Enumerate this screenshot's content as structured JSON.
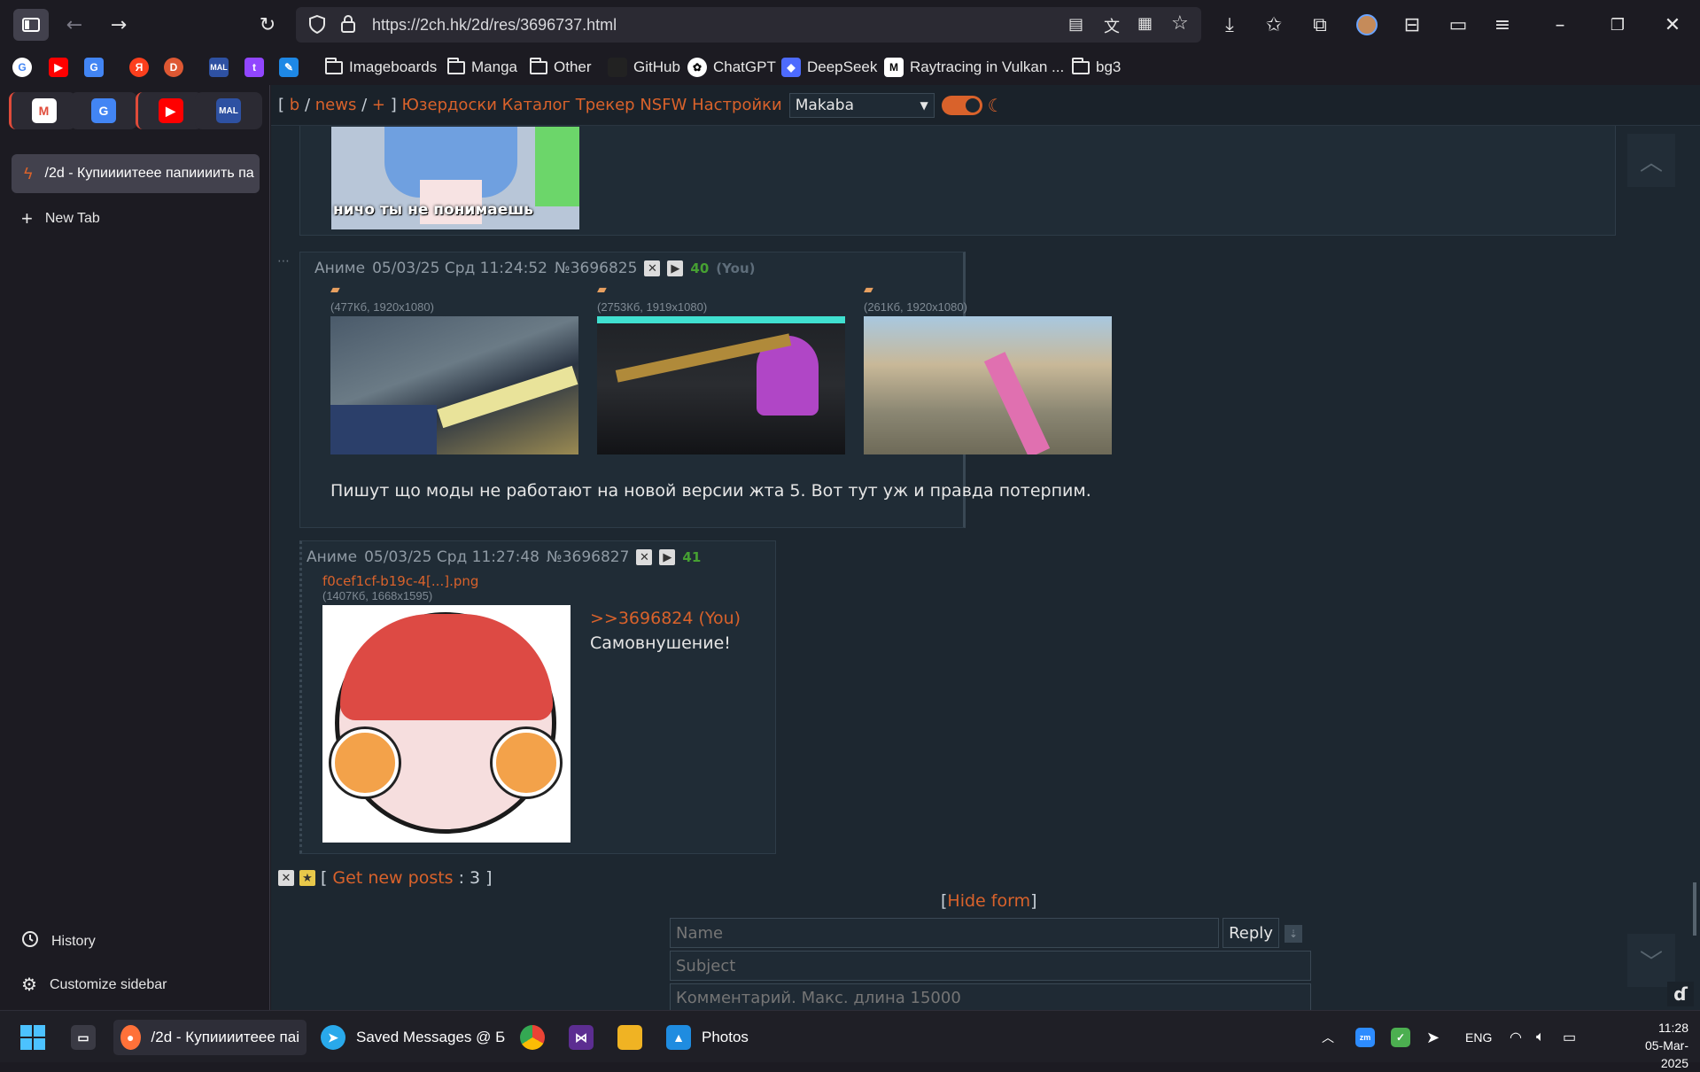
{
  "browser": {
    "url": "https://2ch.hk/2d/res/3696737.html",
    "bookmarks": [
      "Imageboards",
      "Manga",
      "Other",
      "GitHub",
      "ChatGPT",
      "DeepSeek",
      "Raytracing in Vulkan ...",
      "bg3"
    ],
    "bookmark_icon_labels": {
      "mal": "MAL",
      "yandex": "Я"
    },
    "pinned_label_mal": "MAL"
  },
  "sidebar": {
    "active_tab": "/2d - Купиииитеее папиииить па",
    "new_tab": "New Tab",
    "history": "History",
    "customize": "Customize sidebar"
  },
  "board_nav": {
    "open": "[",
    "b": "b",
    "sep1": "/",
    "news": "news",
    "sep2": "/",
    "plus": "+",
    "close": "]",
    "links": [
      "Юзердоски",
      "Каталог",
      "Трекер",
      "NSFW",
      "Настройки"
    ],
    "style_select": "Makaba"
  },
  "image_caption": "ничо ты не понимаешь",
  "posts": [
    {
      "author": "Аниме",
      "date": "05/03/25 Срд 11:24:52",
      "number": "№3696825",
      "index": "40",
      "you": "(You)",
      "files": [
        {
          "info": "(477Кб, 1920x1080)"
        },
        {
          "info": "(2753Кб, 1919x1080)"
        },
        {
          "info": "(261Кб, 1920x1080)"
        }
      ],
      "text": "Пишут що моды не работают на новой версии жта 5. Вот тут уж и правда потерпим."
    },
    {
      "author": "Аниме",
      "date": "05/03/25 Срд 11:27:48",
      "number": "№3696827",
      "index": "41",
      "file_name": "f0cef1cf-b19c-4[...].png",
      "file_info": "(1407Кб, 1668x1595)",
      "reply_link": ">>3696824 (You)",
      "text": "Самовнушение!"
    }
  ],
  "get_new_posts": {
    "open": "[",
    "label": "Get new posts",
    "count": ": 3",
    "close": "]"
  },
  "hide_form": {
    "open": "[",
    "label": "Hide form",
    "close": "]"
  },
  "form": {
    "name_placeholder": "Name",
    "reply_button": "Reply",
    "subject_placeholder": "Subject",
    "comment_placeholder": "Комментарий. Макс. длина 15000"
  },
  "taskbar": {
    "firefox_label": "/2d - Купиииитеее паі",
    "telegram_label": "Saved Messages @ Б",
    "photos_label": "Photos",
    "lang": "ENG",
    "time": "11:28",
    "date": "05-Mar-2025"
  },
  "colors": {
    "accent": "#d9622b",
    "post_bg": "#202c36",
    "page_bg": "#1d2730",
    "green": "#46a032"
  }
}
